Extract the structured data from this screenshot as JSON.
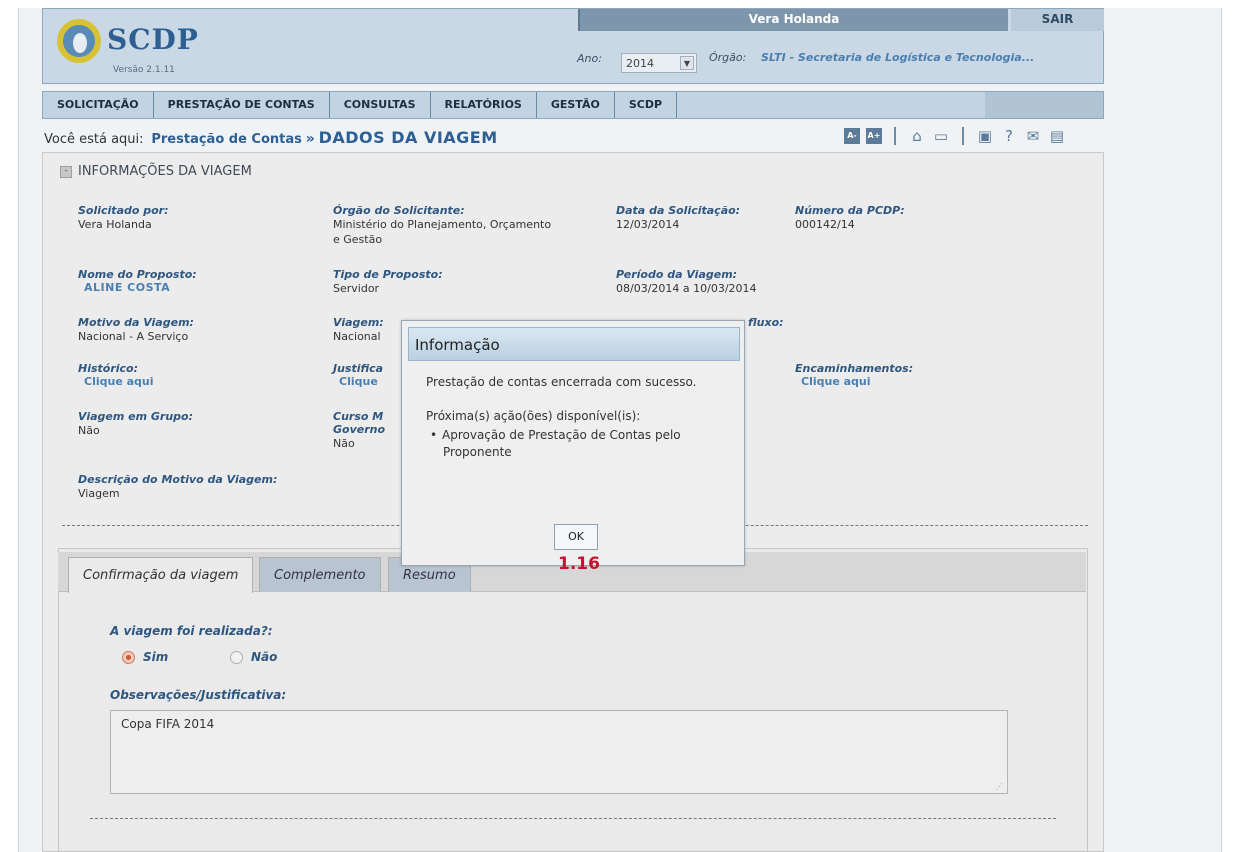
{
  "header": {
    "logo_text": "SCDP",
    "version": "Versão 2.1.11",
    "user_name": "Vera Holanda",
    "logout_label": "SAIR",
    "ano_label": "Ano:",
    "ano_value": "2014",
    "orgao_label": "Órgão:",
    "orgao_value": "SLTI - Secretaria de Logística e Tecnologia..."
  },
  "menu": {
    "items": [
      {
        "label": "SOLICITAÇÃO"
      },
      {
        "label": "PRESTAÇÃO DE CONTAS"
      },
      {
        "label": "CONSULTAS"
      },
      {
        "label": "RELATÓRIOS"
      },
      {
        "label": "GESTÃO"
      },
      {
        "label": "SCDP"
      }
    ]
  },
  "breadcrumb": {
    "prefix": "Você está aqui:",
    "link": "Prestação de Contas",
    "current": "DADOS DA VIAGEM"
  },
  "toolbar": {
    "font_decrease": "A-",
    "font_increase": "A+",
    "icons": [
      "home-icon",
      "chat-icon",
      "presentation-icon",
      "help-icon",
      "mail-icon",
      "feedback-icon"
    ]
  },
  "section": {
    "title": "INFORMAÇÕES DA VIAGEM",
    "collapse_symbol": "-"
  },
  "fields": {
    "solicitado_por": {
      "label": "Solicitado por:",
      "value": "Vera Holanda"
    },
    "orgao_solicitante": {
      "label": "Órgão do Solicitante:",
      "value_line1": "Ministério do Planejamento, Orçamento",
      "value_line2": "e Gestão"
    },
    "data_solicitacao": {
      "label": "Data da Solicitação:",
      "value": "12/03/2014"
    },
    "numero_pcdp": {
      "label": "Número da PCDP:",
      "value": "000142/14"
    },
    "nome_proposto": {
      "label": "Nome do Proposto:",
      "value": "ALINE COSTA"
    },
    "tipo_proposto": {
      "label": "Tipo de Proposto:",
      "value": "Servidor"
    },
    "periodo_viagem": {
      "label": "Período da Viagem:",
      "value": "08/03/2014 a 10/03/2014"
    },
    "motivo_viagem": {
      "label": "Motivo da Viagem:",
      "value": "Nacional - A Serviço"
    },
    "viagem": {
      "label": "Viagem:",
      "value": "Nacional"
    },
    "posicao_fluxo": {
      "label": "fluxo:"
    },
    "historico": {
      "label": "Histórico:",
      "value": "Clique aqui"
    },
    "justificativa": {
      "label": "Justifica",
      "value": "Clique"
    },
    "encaminhamentos": {
      "label": "Encaminhamentos:",
      "value": "Clique aqui"
    },
    "viagem_grupo": {
      "label": "Viagem em Grupo:",
      "value": "Não"
    },
    "curso": {
      "label": "Curso M",
      "label2": "Governo",
      "value": "Não"
    },
    "descricao_motivo": {
      "label": "Descrição do Motivo da Viagem:",
      "value": "Viagem"
    }
  },
  "tabs": [
    {
      "label": "Confirmação da viagem"
    },
    {
      "label": "Complemento"
    },
    {
      "label": "Resumo"
    }
  ],
  "form": {
    "question": "A viagem foi realizada?:",
    "option_yes": "Sim",
    "option_no": "Não",
    "selected": "Sim",
    "obs_label": "Observações/Justificativa:",
    "obs_value": "Copa FIFA 2014"
  },
  "modal": {
    "title": "Informação",
    "message": "Prestação de contas encerrada com sucesso.",
    "next_actions_label": "Próxima(s) ação(ões) disponível(is):",
    "action_line1": "Aprovação de Prestação de Contas pelo",
    "action_line2": "Proponente",
    "ok_label": "OK"
  },
  "annotation": "1.16"
}
